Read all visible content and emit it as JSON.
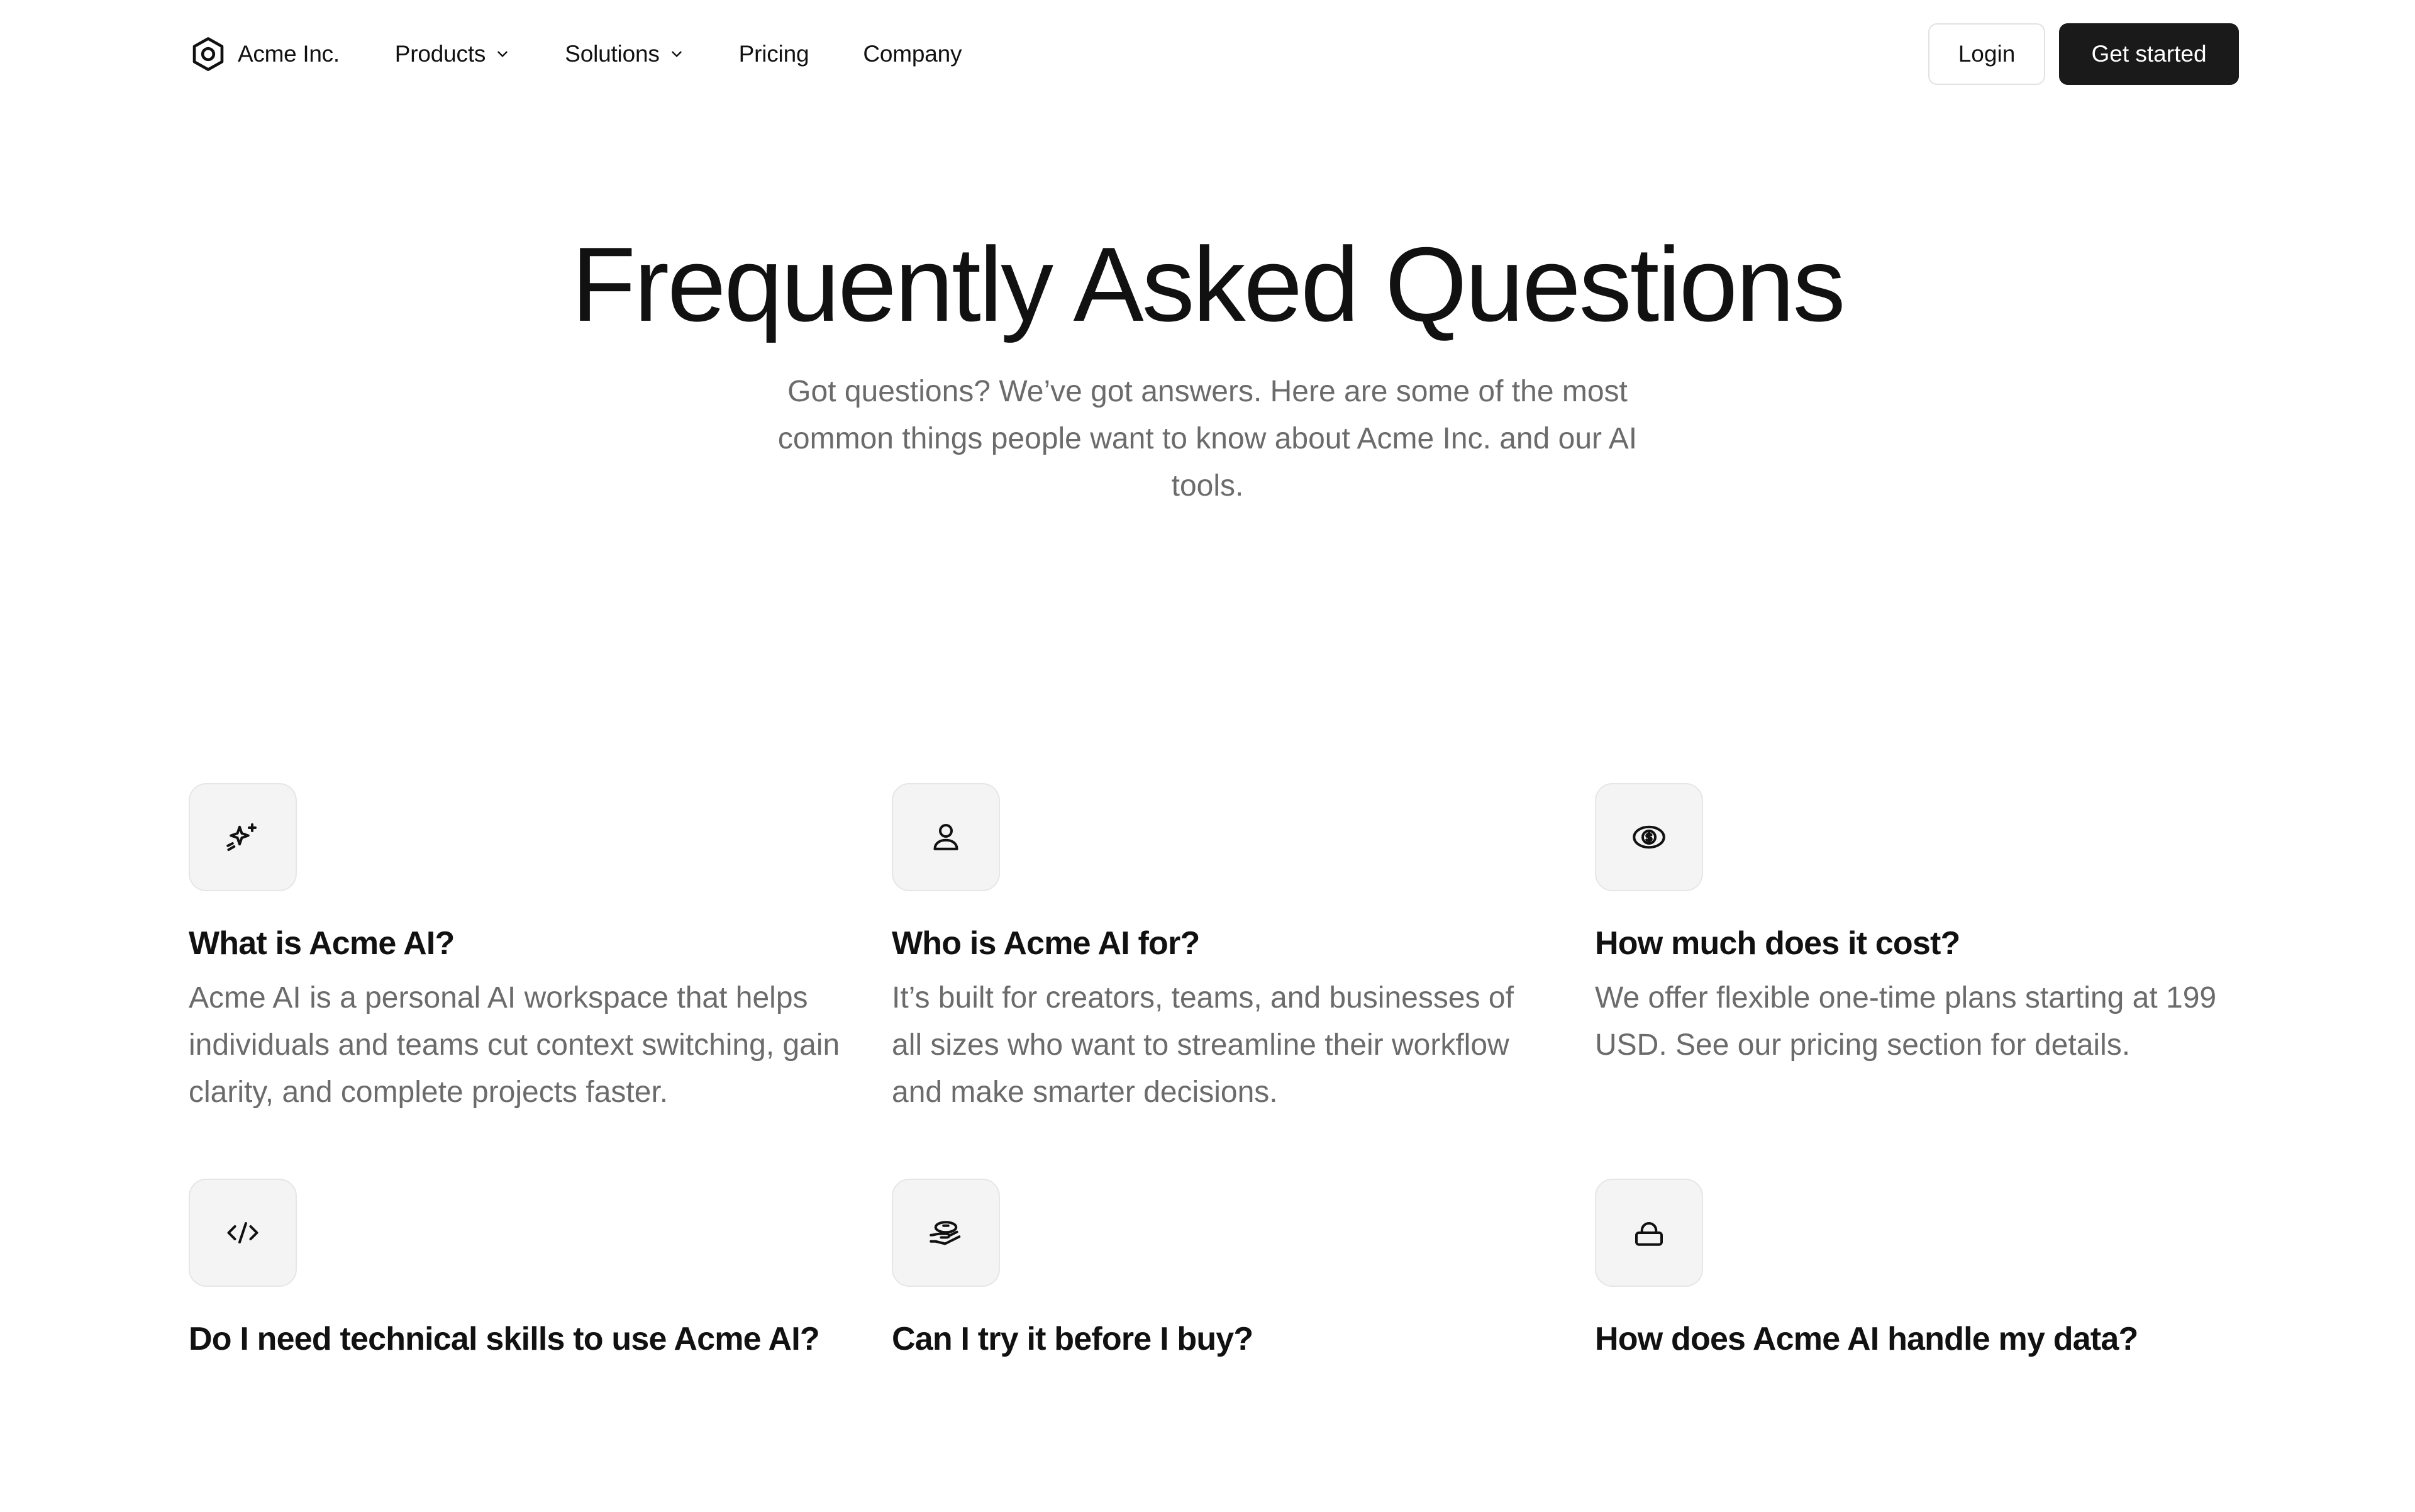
{
  "nav": {
    "brand": "Acme Inc.",
    "links": [
      {
        "label": "Products",
        "has_dropdown": true
      },
      {
        "label": "Solutions",
        "has_dropdown": true
      },
      {
        "label": "Pricing",
        "has_dropdown": false
      },
      {
        "label": "Company",
        "has_dropdown": false
      }
    ],
    "login_label": "Login",
    "cta_label": "Get started"
  },
  "hero": {
    "title": "Frequently Asked Questions",
    "subtitle": "Got questions? We’ve got answers. Here are some of the most common things people want to know about Acme Inc. and our AI tools."
  },
  "faqs": [
    {
      "icon": "sparkles-icon",
      "question": "What is Acme AI?",
      "answer": "Acme AI is a personal AI workspace that helps individuals and teams cut context switching, gain clarity, and complete projects faster."
    },
    {
      "icon": "user-icon",
      "question": "Who is Acme AI for?",
      "answer": "It’s built for creators, teams, and businesses of all sizes who want to streamline their workflow and make smarter decisions."
    },
    {
      "icon": "dollar-icon",
      "question": "How much does it cost?",
      "answer": "We offer flexible one-time plans starting at 199 USD. See our pricing section for details."
    },
    {
      "icon": "code-icon",
      "question": "Do I need technical skills to use Acme AI?",
      "answer": ""
    },
    {
      "icon": "hand-coins-icon",
      "question": "Can I try it before I buy?",
      "answer": ""
    },
    {
      "icon": "lock-icon",
      "question": "How does Acme AI handle my data?",
      "answer": ""
    }
  ],
  "colors": {
    "primary_text": "#111111",
    "muted_text": "#6b6b6b",
    "cta_bg": "#1a1a1a",
    "icon_tile_bg": "#f4f4f4"
  }
}
